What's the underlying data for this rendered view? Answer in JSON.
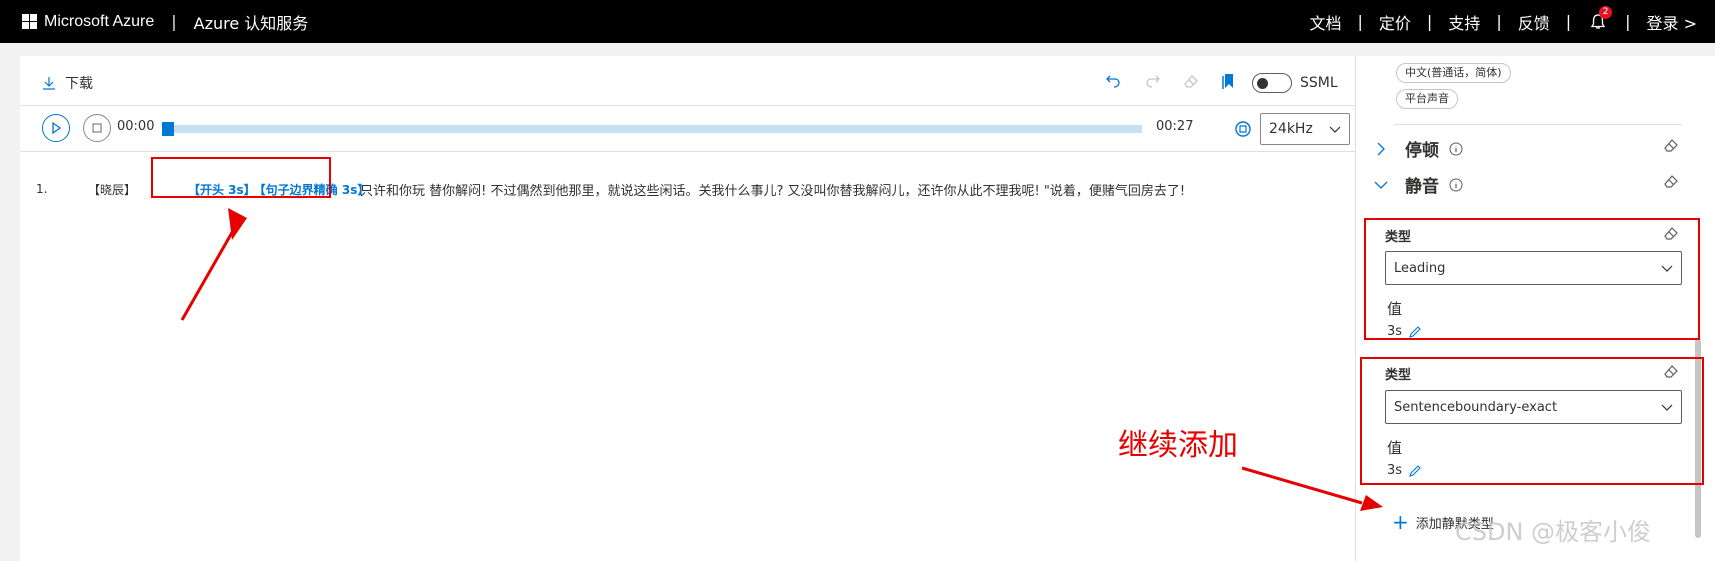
{
  "topbar": {
    "brand": "Microsoft Azure",
    "sep": "|",
    "service": "Azure 认知服务",
    "links": [
      "文档",
      "定价",
      "支持",
      "反馈"
    ],
    "notif_count": "2",
    "login": "登录 >"
  },
  "toolbar": {
    "download": "下载",
    "ssml_label": "SSML"
  },
  "player": {
    "current_time": "00:00",
    "total_time": "00:27",
    "progress_fraction": 0,
    "sample_rate": "24kHz"
  },
  "script": {
    "line_no": "1.",
    "speaker": "【晓辰】",
    "tag1": "【开头 3s】",
    "tag2": "【句子边界精确 3s】",
    "text": "只许和你玩 替你解闷! 不过偶然到他那里，就说这些闲话。关我什么事儿? 又没叫你替我解闷儿，还许你从此不理我呢! \"说着，便赌气回房去了!"
  },
  "panel": {
    "chip1": "中文(普通话，简体)",
    "chip2": "平台声音",
    "section_pause": "停顿",
    "section_silence": "静音",
    "silence_items": [
      {
        "type_label": "类型",
        "type_value": "Leading",
        "value_label": "值",
        "value": "3s"
      },
      {
        "type_label": "类型",
        "type_value": "Sentenceboundary-exact",
        "value_label": "值",
        "value": "3s"
      }
    ],
    "add_label": "添加静默类型"
  },
  "annotation": {
    "text": "继续添加",
    "color": "#e60000"
  },
  "watermark": "CSDN @极客小俊"
}
